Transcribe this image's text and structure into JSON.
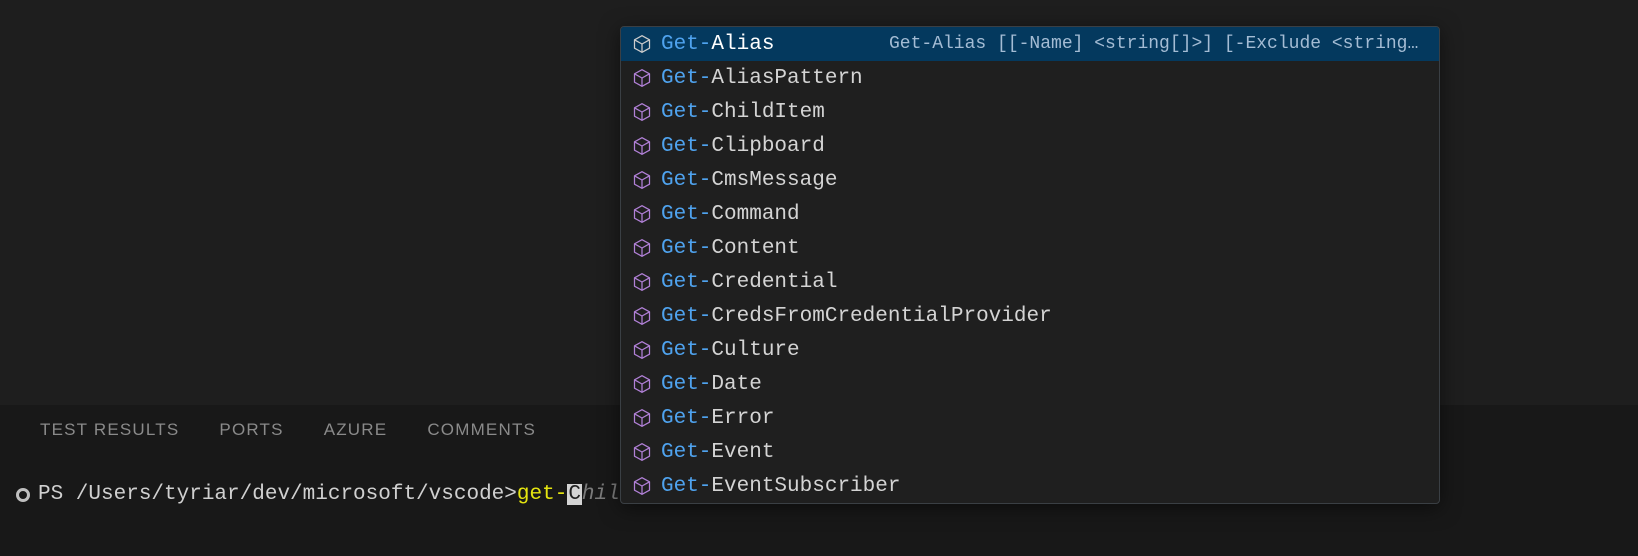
{
  "panel_tabs": [
    "TEST RESULTS",
    "PORTS",
    "AZURE",
    "COMMENTS"
  ],
  "terminal": {
    "prompt": "PS /Users/tyriar/dev/microsoft/vscode> ",
    "typed": "get-",
    "cursor_char": "C",
    "ghost": "hildItem Env:"
  },
  "suggest": {
    "selected_index": 0,
    "match_prefix": "Get-",
    "items": [
      {
        "rest": "Alias",
        "doc": "Get-Alias [[-Name] <string[]>] [-Exclude <string[]>…"
      },
      {
        "rest": "AliasPattern",
        "doc": ""
      },
      {
        "rest": "ChildItem",
        "doc": ""
      },
      {
        "rest": "Clipboard",
        "doc": ""
      },
      {
        "rest": "CmsMessage",
        "doc": ""
      },
      {
        "rest": "Command",
        "doc": ""
      },
      {
        "rest": "Content",
        "doc": ""
      },
      {
        "rest": "Credential",
        "doc": ""
      },
      {
        "rest": "CredsFromCredentialProvider",
        "doc": ""
      },
      {
        "rest": "Culture",
        "doc": ""
      },
      {
        "rest": "Date",
        "doc": ""
      },
      {
        "rest": "Error",
        "doc": ""
      },
      {
        "rest": "Event",
        "doc": ""
      },
      {
        "rest": "EventSubscriber",
        "doc": ""
      }
    ]
  }
}
